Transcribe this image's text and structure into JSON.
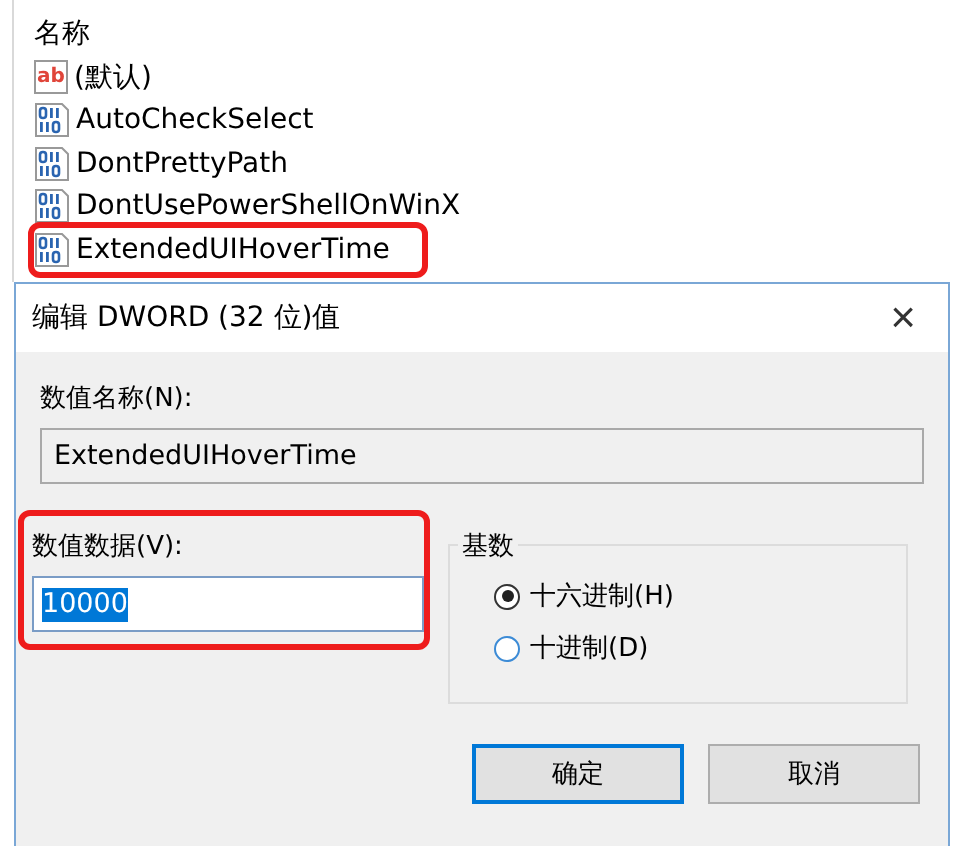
{
  "list": {
    "column": "名称",
    "items": [
      {
        "kind": "string",
        "icon": "ab",
        "name": "(默认)",
        "marked": false
      },
      {
        "kind": "dword",
        "name": "AutoCheckSelect",
        "marked": false
      },
      {
        "kind": "dword",
        "name": "DontPrettyPath",
        "marked": false
      },
      {
        "kind": "dword",
        "name": "DontUsePowerShellOnWinX",
        "marked": false
      },
      {
        "kind": "dword",
        "name": "ExtendedUIHoverTime",
        "marked": true
      }
    ]
  },
  "dialog": {
    "title": "编辑 DWORD (32 位)值",
    "close": "×",
    "value_name": {
      "label": "数值名称(N):",
      "value": "ExtendedUIHoverTime"
    },
    "value_data": {
      "label": "数值数据(V):",
      "value": "10000",
      "marked": true
    },
    "base": {
      "label": "基数",
      "options": [
        {
          "label": "十六进制(H)",
          "selected": true
        },
        {
          "label": "十进制(D)",
          "selected": false
        }
      ]
    },
    "buttons": [
      {
        "label": "确定",
        "default": true
      },
      {
        "label": "取消",
        "default": false
      }
    ]
  }
}
